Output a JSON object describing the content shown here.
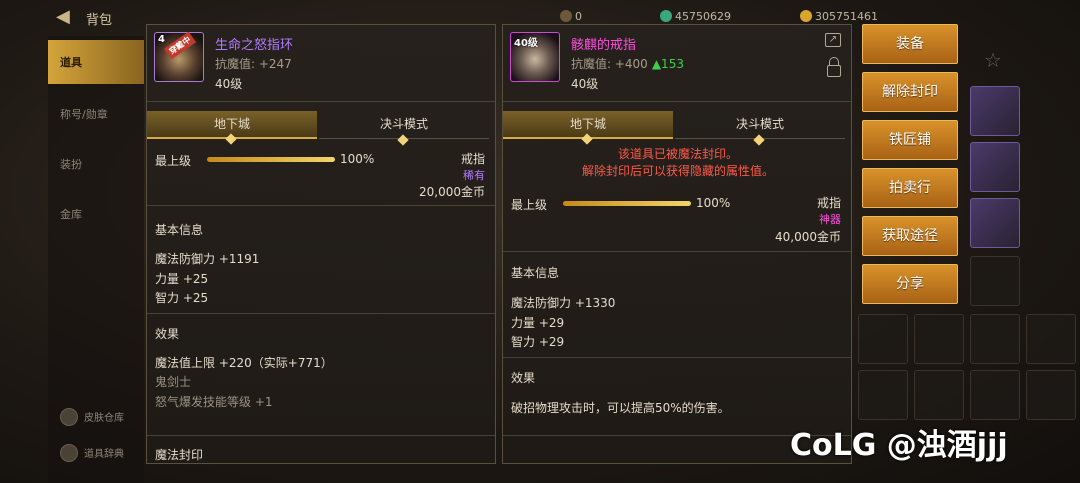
{
  "top_bar": {
    "title": "背包",
    "currency_1": "0",
    "currency_2": "45750629",
    "currency_3": "305751461"
  },
  "sidebar": {
    "items": [
      {
        "label": "道具"
      },
      {
        "label": "称号/勋章"
      },
      {
        "label": "装扮"
      },
      {
        "label": "金库"
      }
    ],
    "bottom_items": [
      {
        "label": "皮肤仓库"
      },
      {
        "label": "道具辞典"
      }
    ]
  },
  "left_item": {
    "level_badge": "4",
    "seal_badge": "穿戴中",
    "name": "生命之怒指环",
    "resist_label": "抗魔值: +247",
    "level": "40级",
    "tabs": [
      "地下城",
      "决斗模式"
    ],
    "grade_label": "最上级",
    "grade_pct": "100%",
    "grade_value": 1.0,
    "type": "戒指",
    "rarity": "稀有",
    "price": "20,000金币",
    "basic_title": "基本信息",
    "stats": [
      "魔法防御力 +1191",
      "力量 +25",
      "智力 +25"
    ],
    "effect_title": "效果",
    "effects": [
      "魔法值上限 +220（实际+771）"
    ],
    "effect_dim": [
      "鬼剑士",
      "怒气爆发技能等级 +1"
    ],
    "seal_title": "魔法封印"
  },
  "right_item": {
    "level_badge": "40级",
    "name": "骸麒的戒指",
    "resist_label": "抗魔值: +400",
    "resist_up": "▲153",
    "level": "40级",
    "tabs": [
      "地下城",
      "决斗模式"
    ],
    "warning_1": "该道具已被魔法封印。",
    "warning_2": "解除封印后可以获得隐藏的属性值。",
    "grade_label": "最上级",
    "grade_pct": "100%",
    "grade_value": 1.0,
    "type": "戒指",
    "rarity": "神器",
    "price": "40,000金币",
    "basic_title": "基本信息",
    "stats": [
      "魔法防御力 +1330",
      "力量 +29",
      "智力 +29"
    ],
    "effect_title": "效果",
    "effects": [
      "破招物理攻击时，可以提高50%的伤害。"
    ]
  },
  "actions": [
    "装备",
    "解除封印",
    "铁匠铺",
    "拍卖行",
    "获取途径",
    "分享"
  ],
  "watermark": "CoLG @浊酒jjj",
  "colors": {
    "accent_gold": "#d9aa3c",
    "rare": "#b27bff",
    "epic": "#ff4de0",
    "warning": "#ff5a4a",
    "button": "#d9922a"
  }
}
